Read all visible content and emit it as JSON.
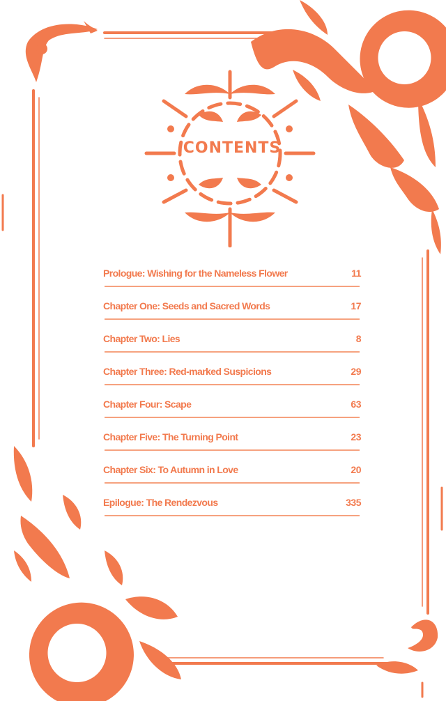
{
  "heading": "CONTENTS",
  "toc": [
    {
      "title": "Prologue: Wishing for the Nameless Flower",
      "page": "11"
    },
    {
      "title": "Chapter One: Seeds and Sacred Words",
      "page": "17"
    },
    {
      "title": "Chapter Two: Lies",
      "page": "8"
    },
    {
      "title": "Chapter Three: Red-marked Suspicions",
      "page": "29"
    },
    {
      "title": "Chapter Four: Scape",
      "page": "63"
    },
    {
      "title": "Chapter Five: The Turning Point",
      "page": "23"
    },
    {
      "title": "Chapter Six: To Autumn in Love",
      "page": "20"
    },
    {
      "title": "Epilogue: The Rendezvous",
      "page": "335"
    }
  ],
  "colors": {
    "accent": "#f27a4e",
    "rule": "#f6a27f",
    "background": "#ffffff"
  }
}
